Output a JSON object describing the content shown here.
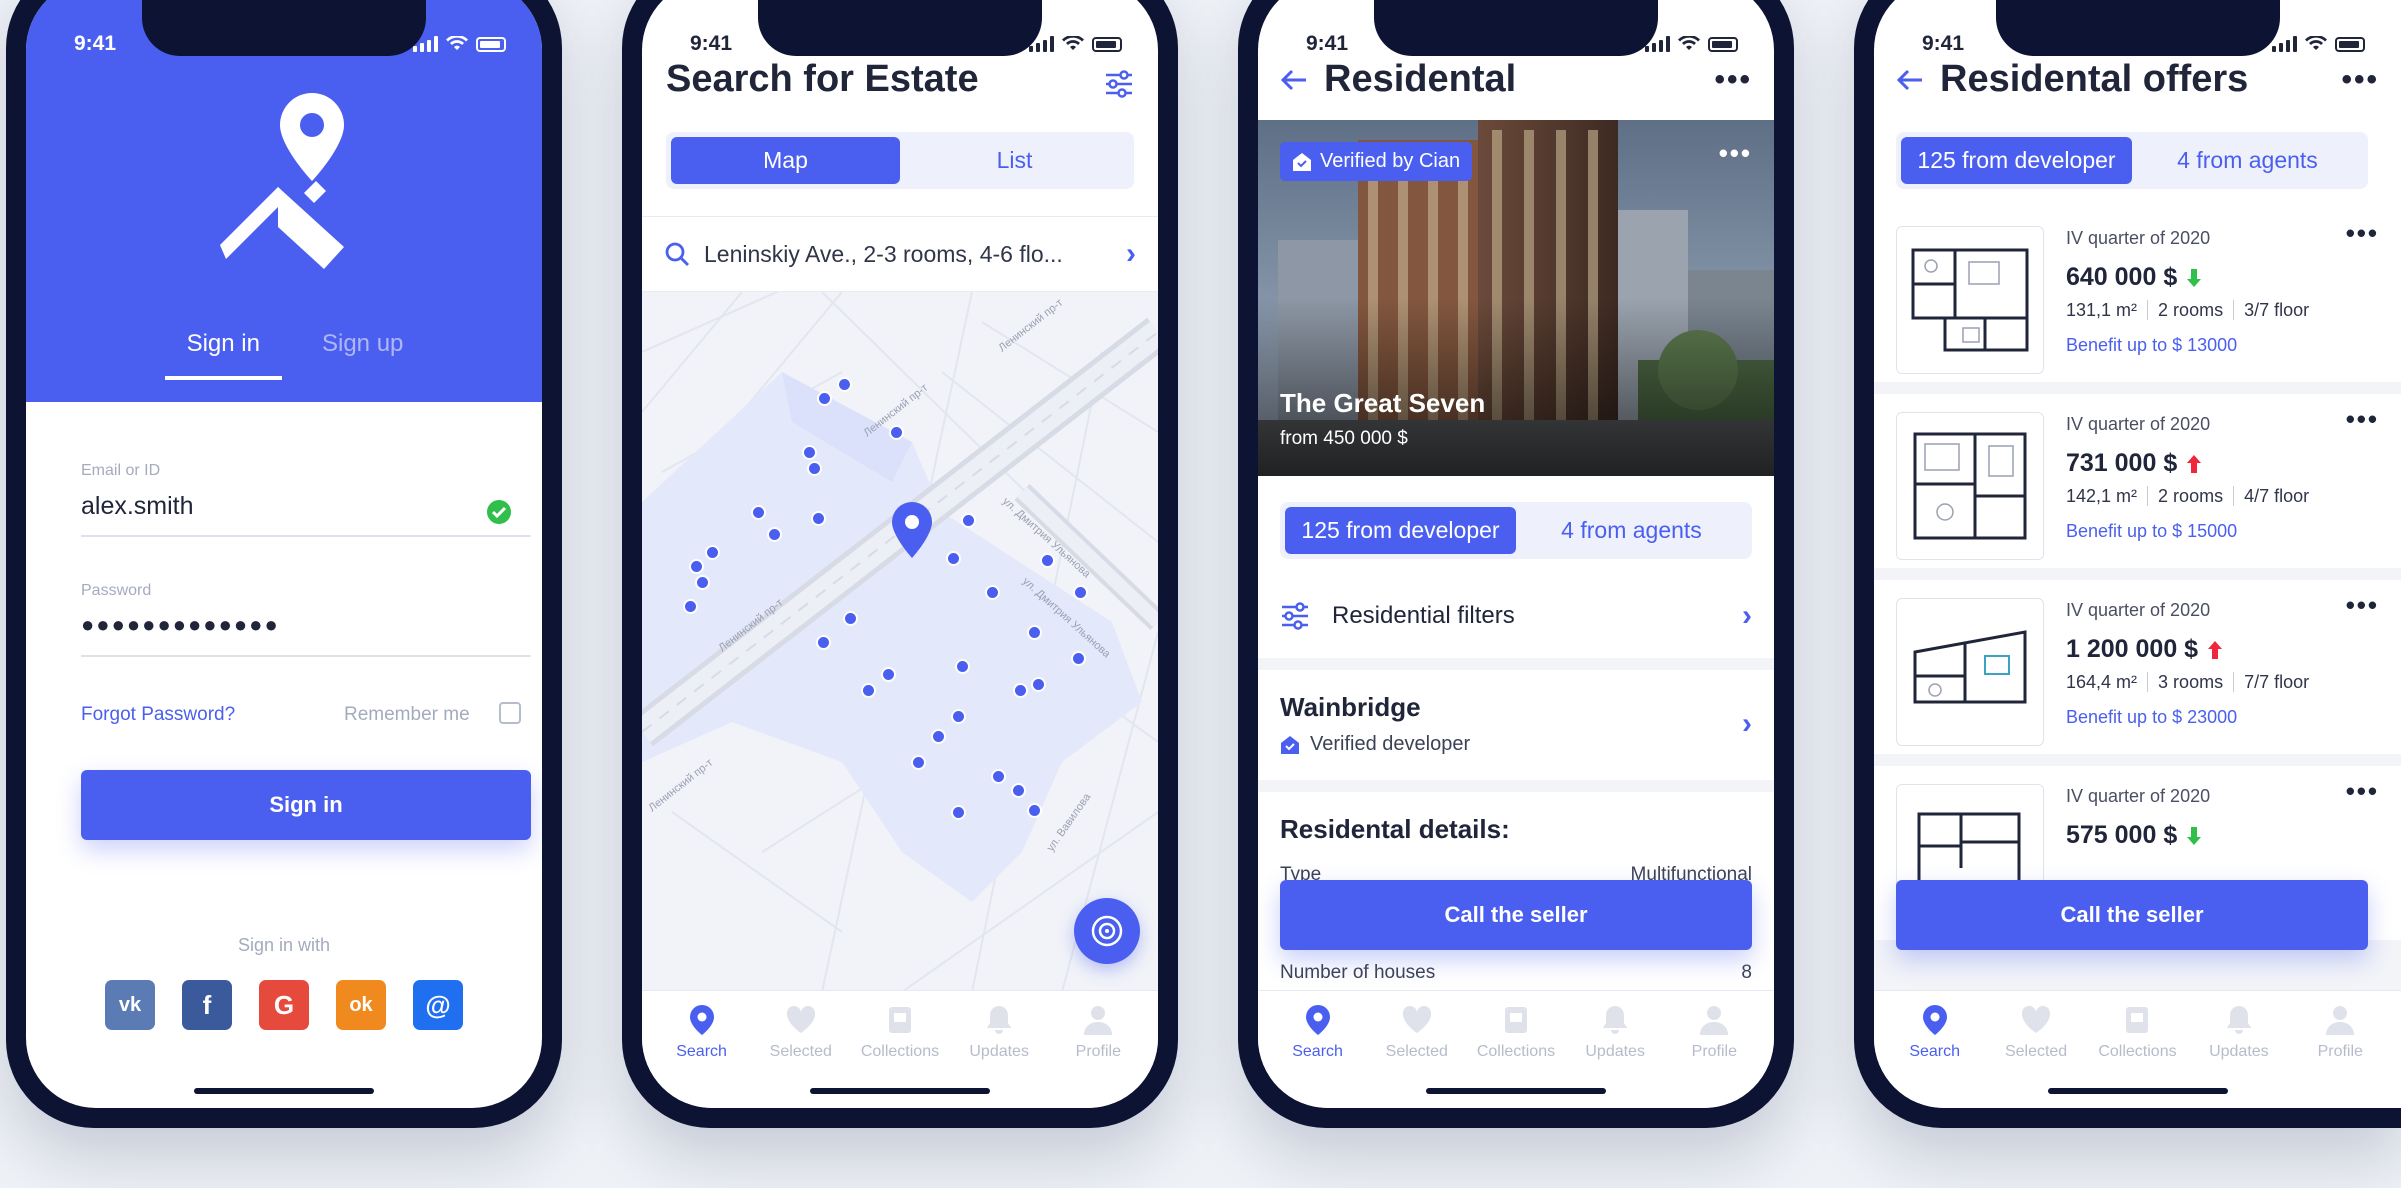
{
  "status_time": "9:41",
  "tabbar": [
    "Search",
    "Selected",
    "Collections",
    "Updates",
    "Profile"
  ],
  "signin": {
    "tab_signin": "Sign in",
    "tab_signup": "Sign up",
    "email_label": "Email or ID",
    "email_value": "alex.smith",
    "password_label": "Password",
    "password_value": "●●●●●●●●●●●●●",
    "forgot": "Forgot Password?",
    "remember": "Remember me",
    "button": "Sign in",
    "sign_in_with": "Sign in with",
    "socials": [
      "vk",
      "f",
      "G",
      "ok",
      "@"
    ]
  },
  "search": {
    "title": "Search for Estate",
    "seg_map": "Map",
    "seg_list": "List",
    "query": "Leninskiy Ave.,  2-3 rooms, 4-6 flo...",
    "streets": [
      "Ленинский пр-т",
      "Ленинский пр-т",
      "Ленинский пр-т",
      "ул. Дмитрия Ульянова",
      "ул. Дмитрия Ульянова",
      "ул. Вавилова",
      "Ленинский пр-т"
    ]
  },
  "residential": {
    "title": "Residental",
    "badge": "Verified by Cian",
    "name": "The Great Seven",
    "from": "from 450 000 $",
    "seg_dev": "125 from developer",
    "seg_agents": "4 from agents",
    "filters": "Residential filters",
    "developer": "Wainbridge",
    "verified": "Verified developer",
    "details": "Residental details:",
    "type_label": "Type",
    "type_value": "Multifunctional",
    "houses_label": "Number of houses",
    "houses_value": "8",
    "cta": "Call the seller"
  },
  "offers": {
    "title": "Residental offers",
    "seg_dev": "125 from developer",
    "seg_agents": "4 from agents",
    "cta": "Call the seller",
    "items": [
      {
        "quarter": "IV quarter of 2020",
        "price": "640 000 $",
        "trend": "down",
        "area": "131,1 m²",
        "rooms": "2 rooms",
        "floor": "3/7 floor",
        "benefit": "Benefit up to $ 13000"
      },
      {
        "quarter": "IV quarter of 2020",
        "price": "731 000 $",
        "trend": "up",
        "area": "142,1 m²",
        "rooms": "2 rooms",
        "floor": "4/7 floor",
        "benefit": "Benefit up to $ 15000"
      },
      {
        "quarter": "IV quarter of 2020",
        "price": "1 200 000 $",
        "trend": "up",
        "area": "164,4 m²",
        "rooms": "3 rooms",
        "floor": "7/7 floor",
        "benefit": "Benefit up to $ 23000"
      },
      {
        "quarter": "IV quarter of 2020",
        "price": "575 000 $",
        "trend": "down",
        "area": "",
        "rooms": "",
        "floor": "",
        "benefit": ""
      }
    ]
  },
  "colors": {
    "accent": "#4a5fef",
    "frame": "#0d1333",
    "up": "#f0263a",
    "down": "#2fbf4a",
    "check": "#2fbf4a"
  }
}
